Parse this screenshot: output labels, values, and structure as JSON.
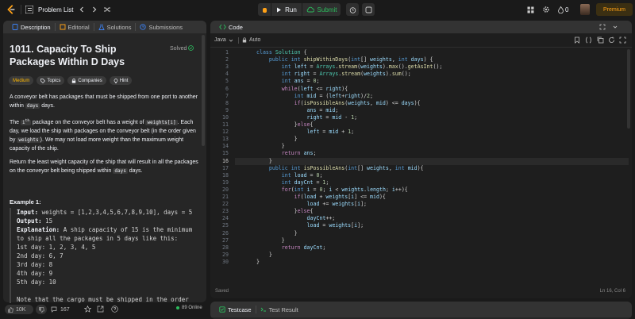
{
  "topbar": {
    "problem_list_label": "Problem List",
    "run_label": "Run",
    "submit_label": "Submit",
    "streak_count": "0",
    "premium_label": "Premium"
  },
  "left_panel": {
    "tabs": [
      {
        "label": "Description",
        "icon": "description-icon"
      },
      {
        "label": "Editorial",
        "icon": "editorial-icon"
      },
      {
        "label": "Solutions",
        "icon": "flask-icon"
      },
      {
        "label": "Submissions",
        "icon": "history-icon"
      }
    ],
    "title": "1011. Capacity To Ship Packages Within D Days",
    "solved_label": "Solved",
    "chips": [
      {
        "label": "Medium"
      },
      {
        "label": "Topics"
      },
      {
        "label": "Companies"
      },
      {
        "label": "Hint"
      }
    ],
    "p1_a": "A conveyor belt has packages that must be shipped from one port to another within ",
    "p1_code": "days",
    "p1_b": " days.",
    "p2_a": "The ",
    "p2_sup_code": "i",
    "p2_sup": "th",
    "p2_b": " package on the conveyor belt has a weight of ",
    "p2_code1": "weights[i]",
    "p2_c": ". Each day, we load the ship with packages on the conveyor belt (in the order given by ",
    "p2_code2": "weights",
    "p2_d": "). We may not load more weight than the maximum weight capacity of the ship.",
    "p3_a": "Return the least weight capacity of the ship that will result in all the packages on the conveyor belt being shipped within ",
    "p3_code": "days",
    "p3_b": " days.",
    "example_title": "Example 1:",
    "example_input_label": "Input:",
    "example_input": " weights = [1,2,3,4,5,6,7,8,9,10], days = 5",
    "example_output_label": "Output:",
    "example_output": " 15",
    "example_expl_label": "Explanation:",
    "example_expl": " A ship capacity of 15 is the minimum\nto ship all the packages in 5 days like this:\n1st day: 1, 2, 3, 4, 5\n2nd day: 6, 7\n3rd day: 8\n4th day: 9\n5th day: 10\n\nNote that the cargo must be shipped in the order",
    "likes": "10K",
    "comments": "167",
    "online": "89 Online"
  },
  "code_panel": {
    "tab_label": "Code",
    "language": "Java",
    "auto_label": "Auto",
    "status_saved": "Saved",
    "cursor_pos": "Ln 16, Col 6",
    "current_line": 16,
    "lines": [
      "class Solution {",
      "    public int shipWithinDays(int[] weights, int days) {",
      "        int left = Arrays.stream(weights).max().getAsInt();",
      "        int right = Arrays.stream(weights).sum();",
      "        int ans = 0;",
      "        while(left <= right){",
      "            int mid = (left+right)/2;",
      "            if(isPossibleAns(weights, mid) <= days){",
      "                ans = mid;",
      "                right = mid - 1;",
      "            }else{",
      "                left = mid + 1;",
      "            }",
      "        }",
      "        return ans;",
      "    }",
      "    public int isPossibleAns(int[] weights, int mid){",
      "        int load = 0;",
      "        int dayCnt = 1;",
      "        for(int i = 0; i < weights.length; i++){",
      "            if(load + weights[i] <= mid){",
      "                load += weights[i];",
      "            }else{",
      "                dayCnt++;",
      "                load = weights[i];",
      "            }",
      "        }",
      "        return dayCnt;",
      "    }",
      "}"
    ]
  },
  "bottom_panel": {
    "testcase_label": "Testcase",
    "test_result_label": "Test Result"
  }
}
